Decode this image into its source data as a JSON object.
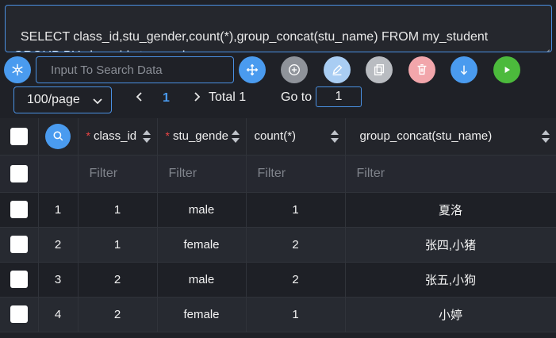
{
  "query": {
    "sql": "SELECT class_id,stu_gender,count(*),group_concat(stu_name) FROM my_student\nGROUP BY class_id,stu_gender"
  },
  "toolbar": {
    "search_placeholder": "Input To Search Data",
    "colors": {
      "blue": "#4a9bef",
      "gray": "#8f939a",
      "light_blue": "#a9cdf3",
      "light_gray": "#b9bcc1",
      "pink": "#f2a6ab",
      "green": "#4cba3c"
    }
  },
  "pager": {
    "page_size": "100/page",
    "current_page": "1",
    "total": "Total 1",
    "goto_label": "Go to",
    "goto_value": "1"
  },
  "table": {
    "columns": [
      {
        "label": "class_id",
        "required": true
      },
      {
        "label": "stu_gende",
        "required": true
      },
      {
        "label": "count(*)",
        "required": false
      },
      {
        "label": "group_concat(stu_name)",
        "required": false
      }
    ],
    "filter_placeholder": "Filter",
    "rows": [
      {
        "index": "1",
        "class_id": "1",
        "stu_gender": "male",
        "count": "1",
        "names": "夏洛"
      },
      {
        "index": "2",
        "class_id": "1",
        "stu_gender": "female",
        "count": "2",
        "names": "张四,小猪"
      },
      {
        "index": "3",
        "class_id": "2",
        "stu_gender": "male",
        "count": "2",
        "names": "张五,小狗"
      },
      {
        "index": "4",
        "class_id": "2",
        "stu_gender": "female",
        "count": "1",
        "names": "小婷"
      }
    ]
  }
}
